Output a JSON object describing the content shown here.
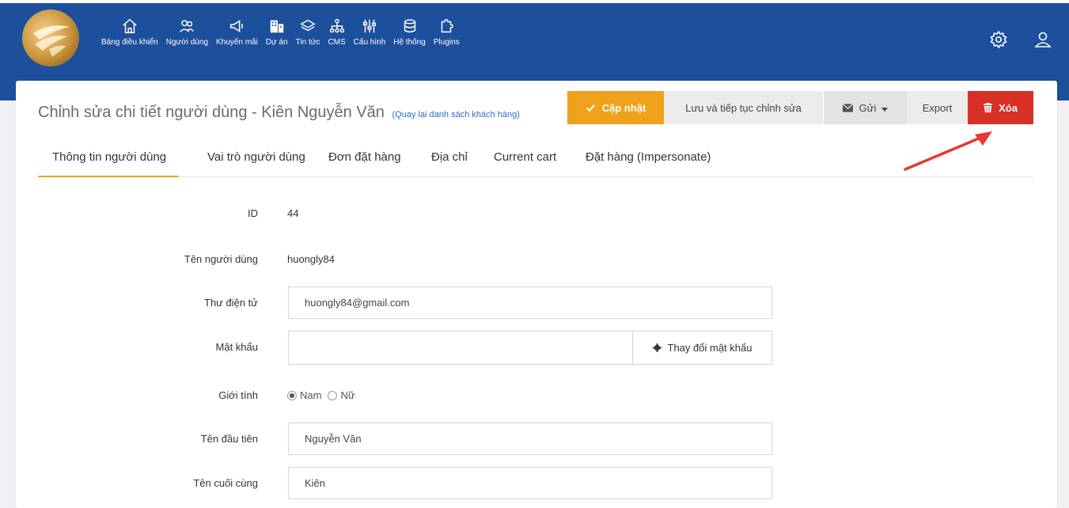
{
  "nav": {
    "items": [
      {
        "label": "Bảng điều khiển",
        "icon": "home-icon"
      },
      {
        "label": "Người dùng",
        "icon": "users-icon"
      },
      {
        "label": "Khuyến mãi",
        "icon": "megaphone-icon"
      },
      {
        "label": "Dự án",
        "icon": "building-icon"
      },
      {
        "label": "Tin tức",
        "icon": "layers-icon"
      },
      {
        "label": "CMS",
        "icon": "sitemap-icon"
      },
      {
        "label": "Cấu hình",
        "icon": "sliders-icon"
      },
      {
        "label": "Hệ thống",
        "icon": "database-icon"
      },
      {
        "label": "Plugins",
        "icon": "puzzle-icon"
      }
    ],
    "right_icons": [
      "gear-icon",
      "user-icon"
    ]
  },
  "header": {
    "title": "Chỉnh sửa chi tiết người dùng - Kiên Nguyễn Văn",
    "back_link": "(Quay lại danh sách khách hàng)"
  },
  "actions": {
    "update": "Cập nhật",
    "save_continue": "Lưu và tiếp tục chỉnh sửa",
    "send": "Gửi",
    "export": "Export",
    "delete": "Xóa"
  },
  "tabs": [
    {
      "label": "Thông tin người dùng",
      "active": true
    },
    {
      "label": "Vai trò người dùng",
      "active": false
    },
    {
      "label": "Đơn đặt hàng",
      "active": false
    },
    {
      "label": "Địa chỉ",
      "active": false
    },
    {
      "label": "Current cart",
      "active": false
    },
    {
      "label": "Đặt hàng (Impersonate)",
      "active": false
    }
  ],
  "form": {
    "id": {
      "label": "ID",
      "value": "44"
    },
    "username": {
      "label": "Tên người dùng",
      "value": "huongly84"
    },
    "email": {
      "label": "Thư điện tử",
      "value": "huongly84@gmail.com"
    },
    "password": {
      "label": "Mật khẩu",
      "value": "",
      "button": "Thay đổi mật khẩu"
    },
    "gender": {
      "label": "Giới tính",
      "options": [
        "Nam",
        "Nữ"
      ],
      "selected": "Nam"
    },
    "first_name": {
      "label": "Tên đầu tiên",
      "value": "Nguyễn Văn"
    },
    "last_name": {
      "label": "Tên cuối cùng",
      "value": "Kiên"
    }
  },
  "colors": {
    "nav_bg": "#1c4f9c",
    "accent": "#f0a21d",
    "danger": "#d93025",
    "arrow": "#e53935"
  }
}
